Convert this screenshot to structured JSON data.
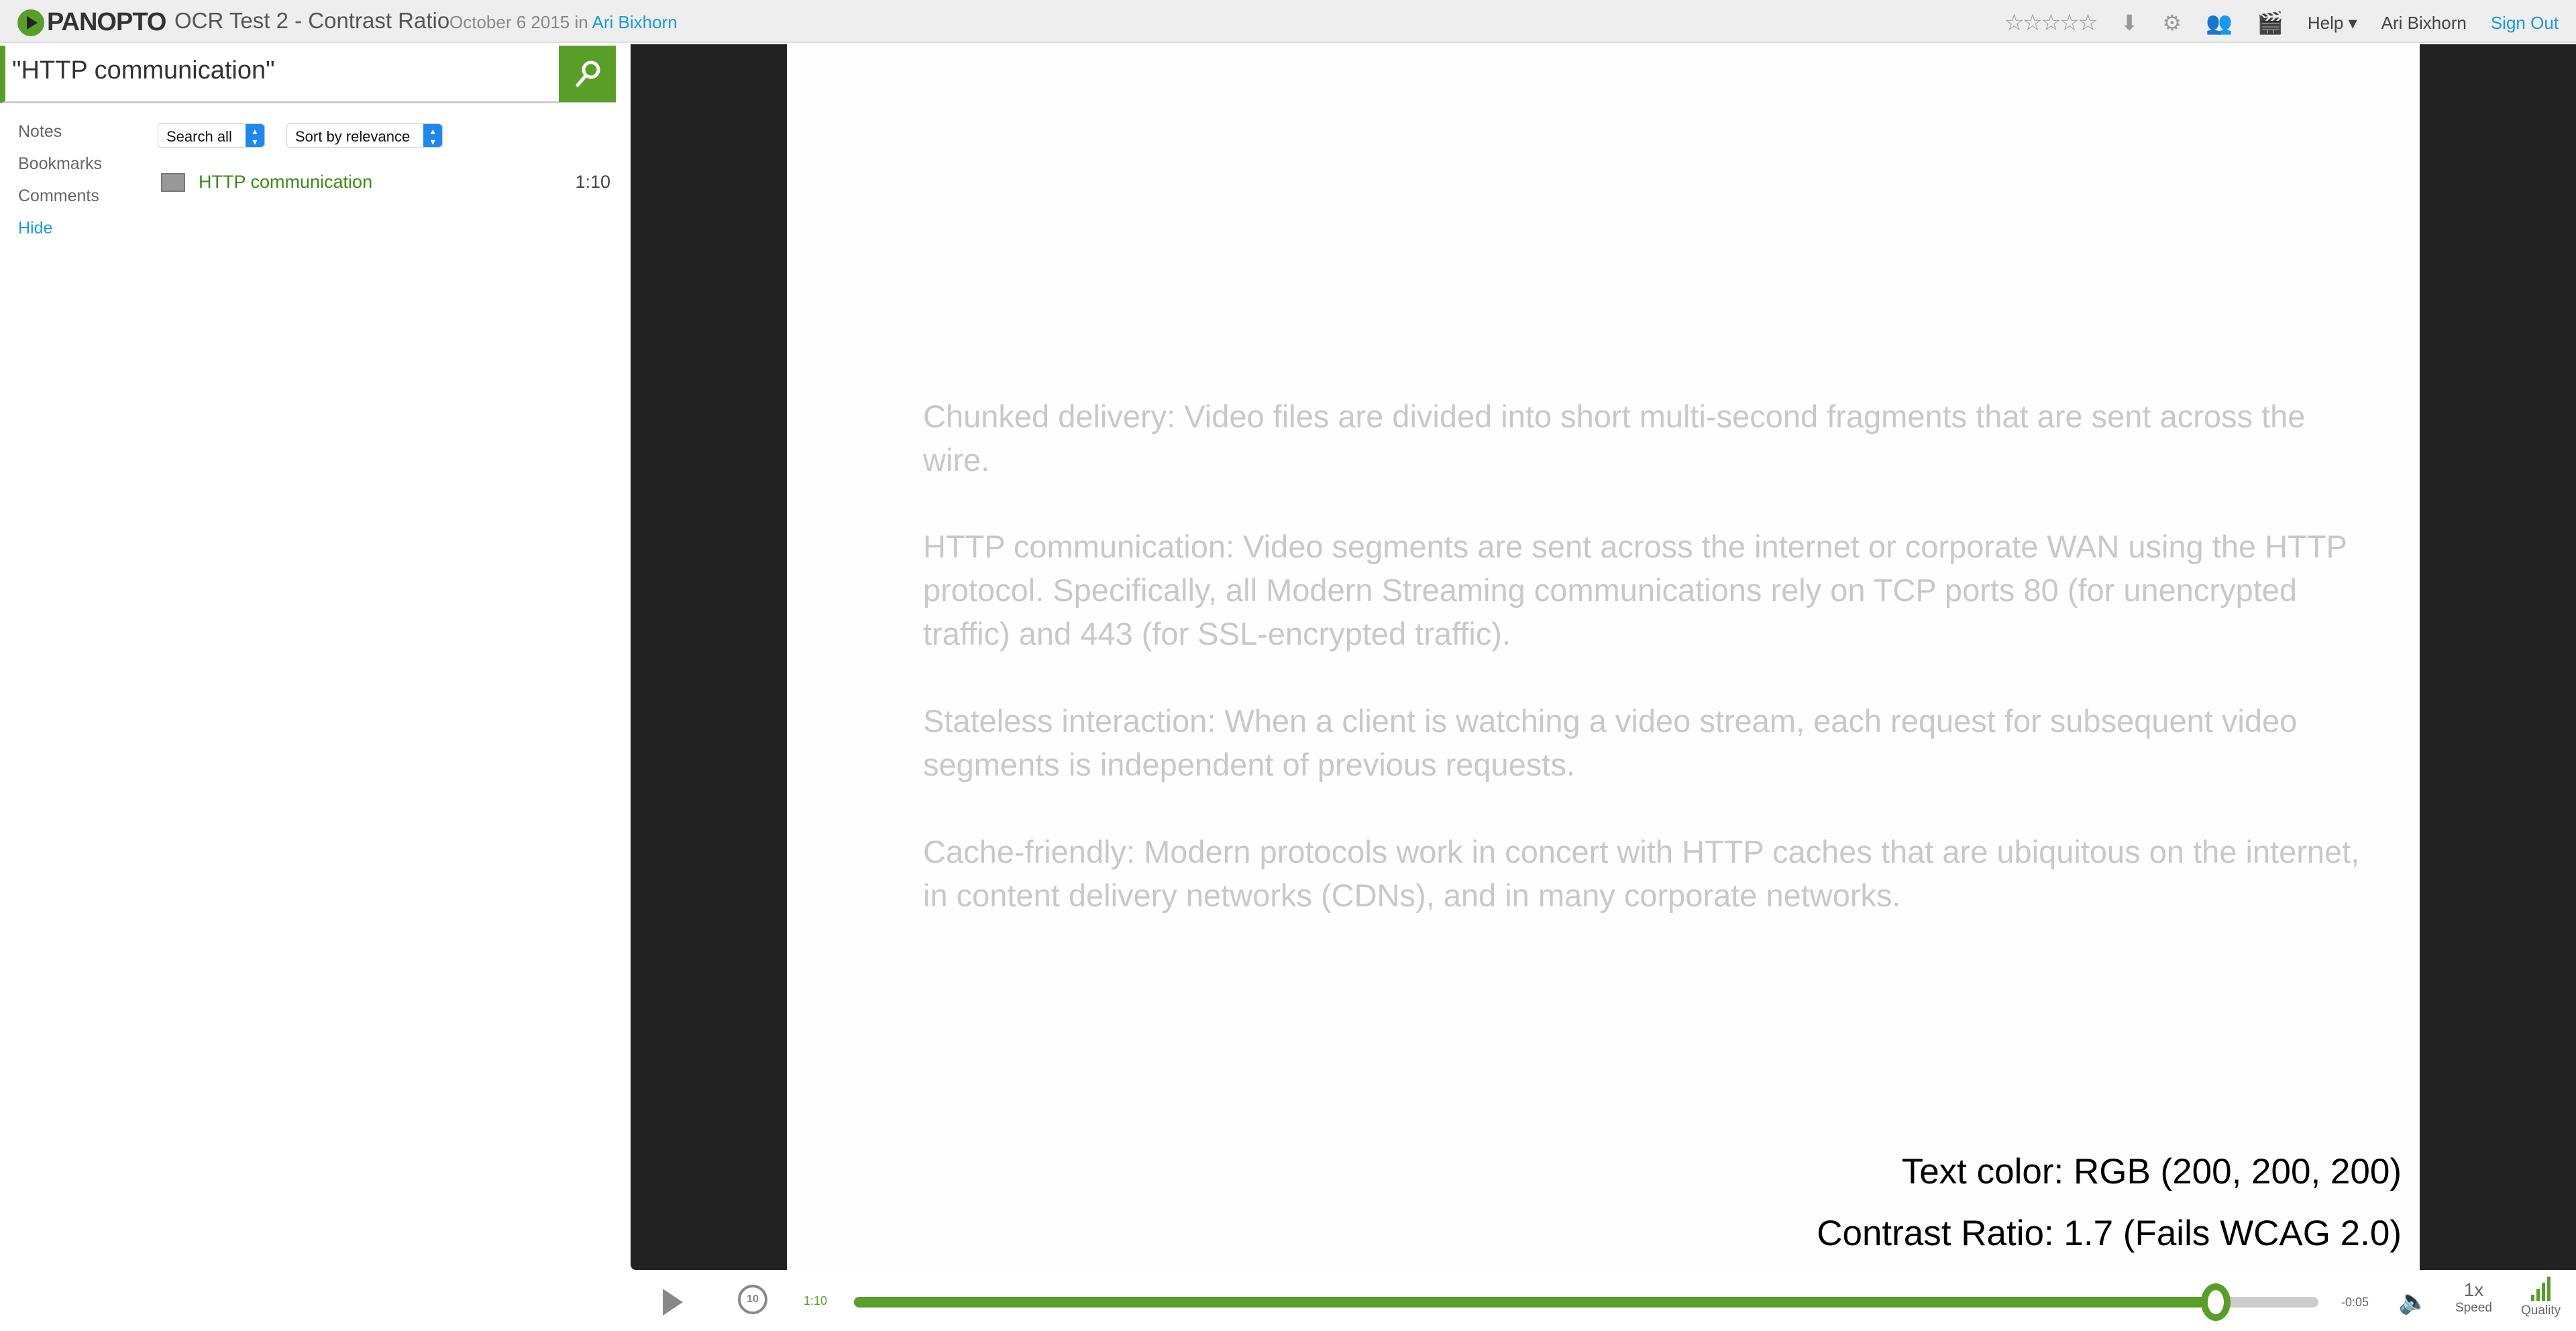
{
  "header": {
    "logo": "PANOPTO",
    "title": "OCR Test 2 - Contrast Ratio",
    "date": "October 6 2015",
    "in": "in",
    "author": "Ari Bixhorn",
    "rating_stars": 0,
    "help": "Help",
    "user": "Ari Bixhorn",
    "sign_out": "Sign Out"
  },
  "sidebar": {
    "search_value": "\"HTTP communication\"",
    "nav": [
      "Notes",
      "Bookmarks",
      "Comments",
      "Hide"
    ],
    "filter": "Search all",
    "sort": "Sort by relevance",
    "results": [
      {
        "label": "HTTP communication",
        "time": "1:10"
      }
    ]
  },
  "slide": {
    "paragraphs": [
      "Chunked delivery: Video files are divided into short multi-second fragments that are sent across the wire.",
      "HTTP communication: Video segments are sent across the internet or corporate WAN using the HTTP protocol. Specifically, all Modern Streaming communications rely on TCP ports 80 (for unencrypted traffic) and 443 (for SSL-encrypted traffic).",
      "Stateless interaction: When a client is watching a video stream, each request for subsequent video segments is independent of previous requests.",
      "Cache-friendly: Modern protocols work in concert with HTTP caches that are ubiquitous on the internet, in content delivery networks (CDNs), and in many corporate networks."
    ],
    "text_color": "#c8c8c8",
    "note1": "Text color: RGB (200, 200, 200)",
    "note2": "Contrast Ratio: 1.7 (Fails WCAG 2.0)"
  },
  "player": {
    "current": "1:10",
    "remaining": "-0:05",
    "progress_percent": 93,
    "rewind": "10",
    "speed": "1x",
    "speed_label": "Speed",
    "quality_label": "Quality",
    "accent": "#5a9e2a"
  }
}
